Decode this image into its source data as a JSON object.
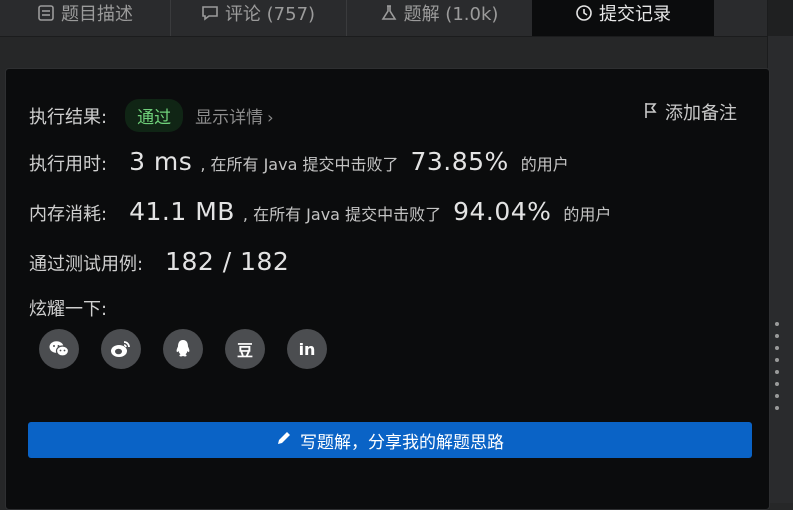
{
  "tabs": [
    {
      "label": "题目描述",
      "icon": "document-icon"
    },
    {
      "label": "评论 (757)",
      "icon": "comment-icon"
    },
    {
      "label": "题解 (1.0k)",
      "icon": "flask-icon"
    },
    {
      "label": "提交记录",
      "icon": "clock-icon",
      "active": true
    }
  ],
  "result": {
    "label": "执行结果:",
    "status": "通过",
    "detail_label": "显示详情",
    "note_label": "添加备注"
  },
  "runtime": {
    "label": "执行用时:",
    "value": "3 ms",
    "prefix": ", 在所有 Java 提交中击败了",
    "percent": "73.85%",
    "suffix": "的用户"
  },
  "memory": {
    "label": "内存消耗:",
    "value": "41.1 MB",
    "prefix": ", 在所有 Java 提交中击败了",
    "percent": "94.04%",
    "suffix": "的用户"
  },
  "tests": {
    "label": "通过测试用例:",
    "value": "182 / 182"
  },
  "share": {
    "label": "炫耀一下:",
    "icons": [
      "wechat-icon",
      "weibo-icon",
      "qq-icon",
      "douban-icon",
      "linkedin-icon"
    ],
    "douban_glyph": "豆",
    "linkedin_glyph": "in"
  },
  "write_button": "写题解，分享我的解题思路",
  "colors": {
    "accent": "#0a63c6",
    "pass": "#6fd07a",
    "panel": "#0b0c0d"
  }
}
